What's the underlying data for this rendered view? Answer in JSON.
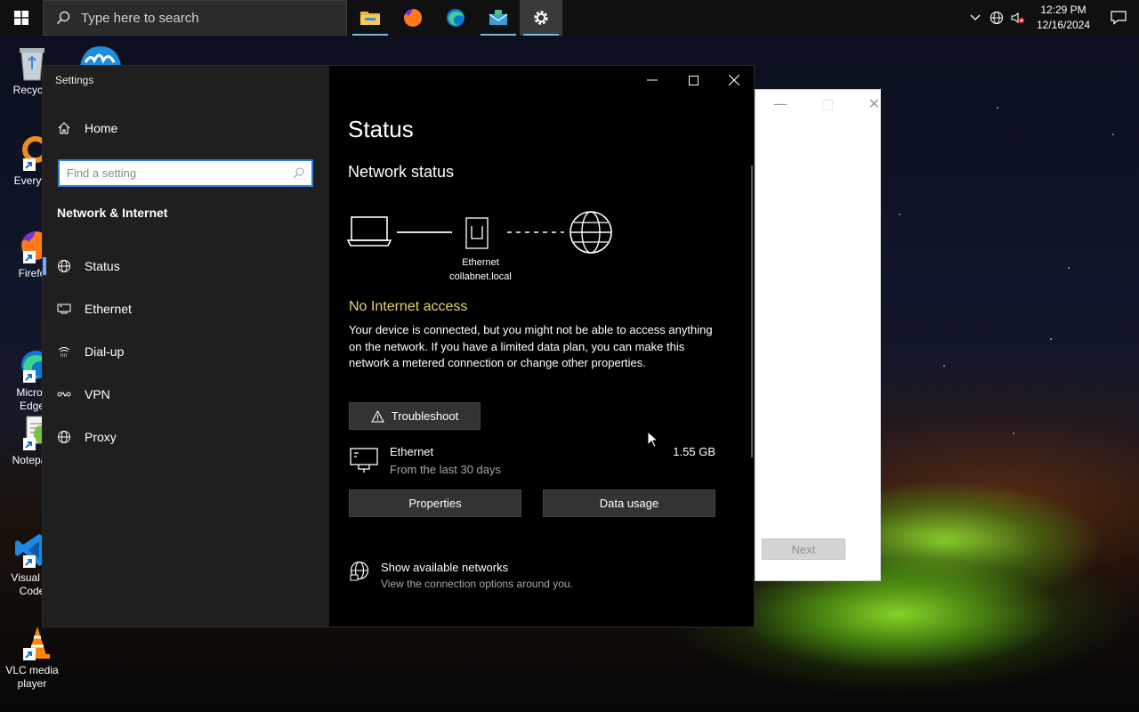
{
  "taskbar": {
    "search_placeholder": "Type here to search",
    "pinned": [
      "file-explorer",
      "firefox",
      "edge",
      "mail-app",
      "settings"
    ],
    "clock_time": "12:29 PM",
    "clock_date": "12/16/2024"
  },
  "desktop": {
    "icons": [
      {
        "label": "Recycle",
        "icon": "recycle-bin-icon"
      },
      {
        "label": "Everyth",
        "icon": "everything-search-icon"
      },
      {
        "label": "Firefo",
        "icon": "firefox-icon"
      },
      {
        "label": "Micros\nEdge",
        "icon": "edge-icon"
      },
      {
        "label": "Notepac",
        "icon": "notepad-plus-icon"
      },
      {
        "label": "Visual St\nCode",
        "icon": "vscode-icon"
      },
      {
        "label": "VLC media\nplayer",
        "icon": "vlc-icon"
      }
    ]
  },
  "bg_dialog": {
    "next_label": "Next"
  },
  "settings": {
    "title": "Settings",
    "home_label": "Home",
    "find_placeholder": "Find a setting",
    "section": "Network & Internet",
    "nav": [
      {
        "label": "Status",
        "icon": "globe-icon"
      },
      {
        "label": "Ethernet",
        "icon": "ethernet-icon"
      },
      {
        "label": "Dial-up",
        "icon": "dialup-icon"
      },
      {
        "label": "VPN",
        "icon": "vpn-icon"
      },
      {
        "label": "Proxy",
        "icon": "globe-icon"
      }
    ],
    "page_title": "Status",
    "network_status_heading": "Network status",
    "adapter_label": "Ethernet",
    "domain_label": "collabnet.local",
    "internet_state": "No Internet access",
    "internet_state_color": "#e8d36a",
    "description": "Your device is connected, but you might not be able to access anything on the network. If you have a limited data plan, you can make this network a metered connection or change other properties.",
    "troubleshoot_label": "Troubleshoot",
    "connection": {
      "name": "Ethernet",
      "period": "From the last 30 days",
      "usage": "1.55 GB"
    },
    "properties_label": "Properties",
    "data_usage_label": "Data usage",
    "show_networks_title": "Show available networks",
    "show_networks_desc": "View the connection options around you."
  }
}
